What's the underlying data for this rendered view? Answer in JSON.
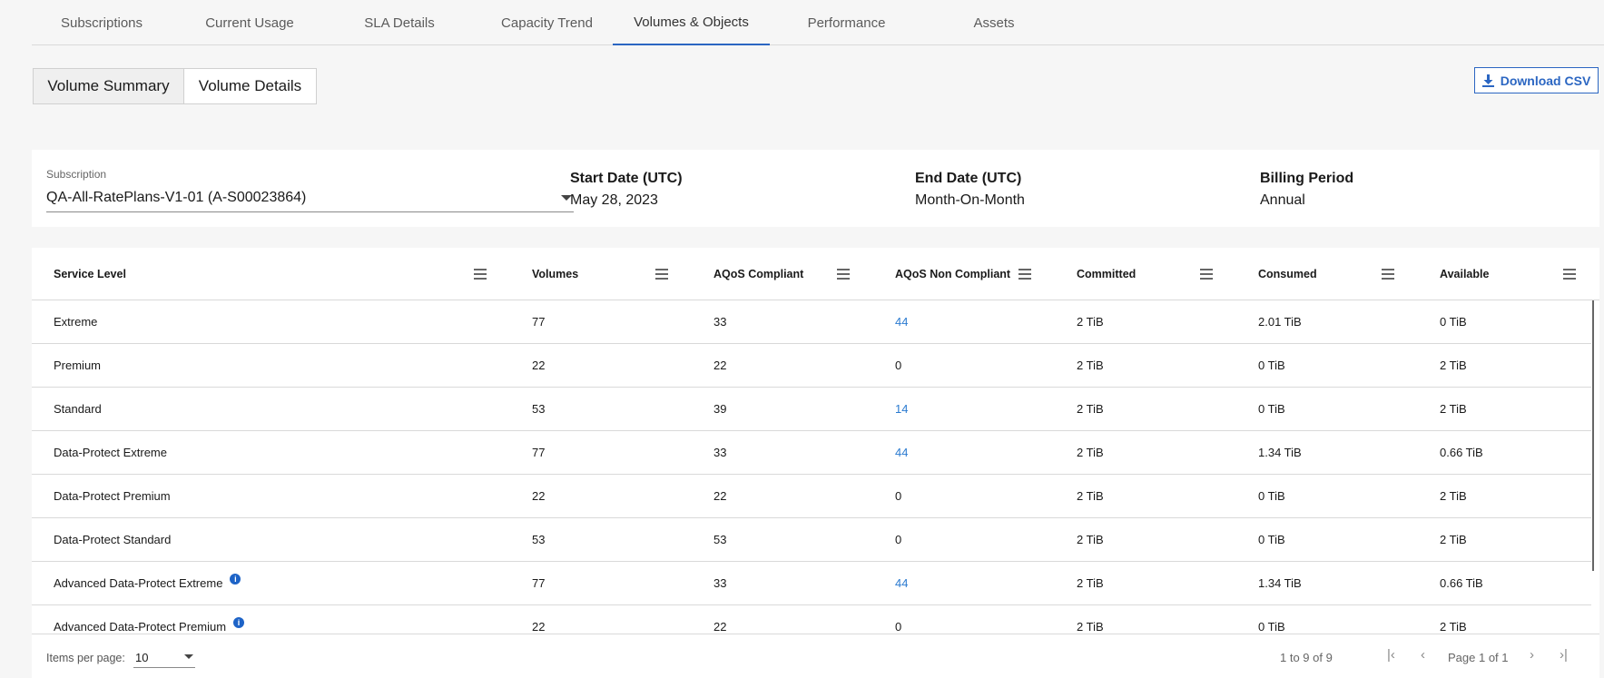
{
  "tabs": [
    "Subscriptions",
    "Current Usage",
    "SLA Details",
    "Capacity Trend",
    "Volumes & Objects",
    "Performance",
    "Assets"
  ],
  "active_tab": "Volumes & Objects",
  "views": {
    "summary": "Volume Summary",
    "details": "Volume Details",
    "active": "Volume Summary"
  },
  "download_label": "Download CSV",
  "subscription": {
    "label": "Subscription",
    "value": "QA-All-RatePlans-V1-01 (A-S00023864)"
  },
  "start_date": {
    "heading": "Start Date (UTC)",
    "value": "May 28, 2023"
  },
  "end_date": {
    "heading": "End Date (UTC)",
    "value": "Month-On-Month"
  },
  "billing_period": {
    "heading": "Billing Period",
    "value": "Annual"
  },
  "table": {
    "columns": [
      "Service Level",
      "Volumes",
      "AQoS Compliant",
      "AQoS Non Compliant",
      "Committed",
      "Consumed",
      "Available"
    ],
    "rows": [
      {
        "service_level": "Extreme",
        "volumes": "77",
        "compliant": "33",
        "non_compliant": "44",
        "committed": "2 TiB",
        "consumed": "2.01 TiB",
        "available": "0 TiB"
      },
      {
        "service_level": "Premium",
        "volumes": "22",
        "compliant": "22",
        "non_compliant": "0",
        "committed": "2 TiB",
        "consumed": "0 TiB",
        "available": "2 TiB"
      },
      {
        "service_level": "Standard",
        "volumes": "53",
        "compliant": "39",
        "non_compliant": "14",
        "committed": "2 TiB",
        "consumed": "0 TiB",
        "available": "2 TiB"
      },
      {
        "service_level": "Data-Protect Extreme",
        "volumes": "77",
        "compliant": "33",
        "non_compliant": "44",
        "committed": "2 TiB",
        "consumed": "1.34 TiB",
        "available": "0.66 TiB"
      },
      {
        "service_level": "Data-Protect Premium",
        "volumes": "22",
        "compliant": "22",
        "non_compliant": "0",
        "committed": "2 TiB",
        "consumed": "0 TiB",
        "available": "2 TiB"
      },
      {
        "service_level": "Data-Protect Standard",
        "volumes": "53",
        "compliant": "53",
        "non_compliant": "0",
        "committed": "2 TiB",
        "consumed": "0 TiB",
        "available": "2 TiB"
      },
      {
        "service_level": "Advanced Data-Protect Extreme",
        "volumes": "77",
        "compliant": "33",
        "non_compliant": "44",
        "committed": "2 TiB",
        "consumed": "1.34 TiB",
        "available": "0.66 TiB"
      },
      {
        "service_level": "Advanced Data-Protect Premium",
        "volumes": "22",
        "compliant": "22",
        "non_compliant": "0",
        "committed": "2 TiB",
        "consumed": "0 TiB",
        "available": "2 TiB"
      }
    ]
  },
  "pagination": {
    "items_per_page_label": "Items per page:",
    "items_per_page": "10",
    "range": "1 to 9 of 9",
    "page_label": "Page 1 of 1"
  },
  "colors": {
    "accent": "#2b66c2",
    "link": "#2b7bd0"
  },
  "icons": {
    "download": "download-icon",
    "column_menu": "menu-icon",
    "info": "info-icon",
    "first": "first-page-icon",
    "prev": "prev-page-icon",
    "next": "next-page-icon",
    "last": "last-page-icon"
  }
}
